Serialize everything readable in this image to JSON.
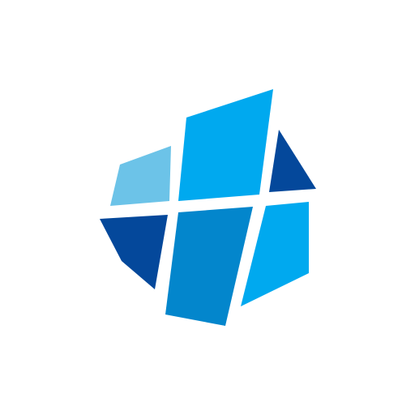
{
  "logo": {
    "icon": "faceted-hexagon-logo-icon",
    "colors": {
      "background": "#ffffff",
      "light_blue": "#6cc3e8",
      "bright_blue": "#00a9ef",
      "medium_blue": "#0386cc",
      "dark_blue": "#04489b"
    },
    "facets": [
      {
        "name": "logo-facet-top-left",
        "color_key": "light_blue"
      },
      {
        "name": "logo-facet-top-center",
        "color_key": "bright_blue"
      },
      {
        "name": "logo-facet-top-right",
        "color_key": "dark_blue"
      },
      {
        "name": "logo-facet-bottom-left",
        "color_key": "dark_blue"
      },
      {
        "name": "logo-facet-bottom-center",
        "color_key": "medium_blue"
      },
      {
        "name": "logo-facet-bottom-right",
        "color_key": "bright_blue"
      }
    ]
  }
}
